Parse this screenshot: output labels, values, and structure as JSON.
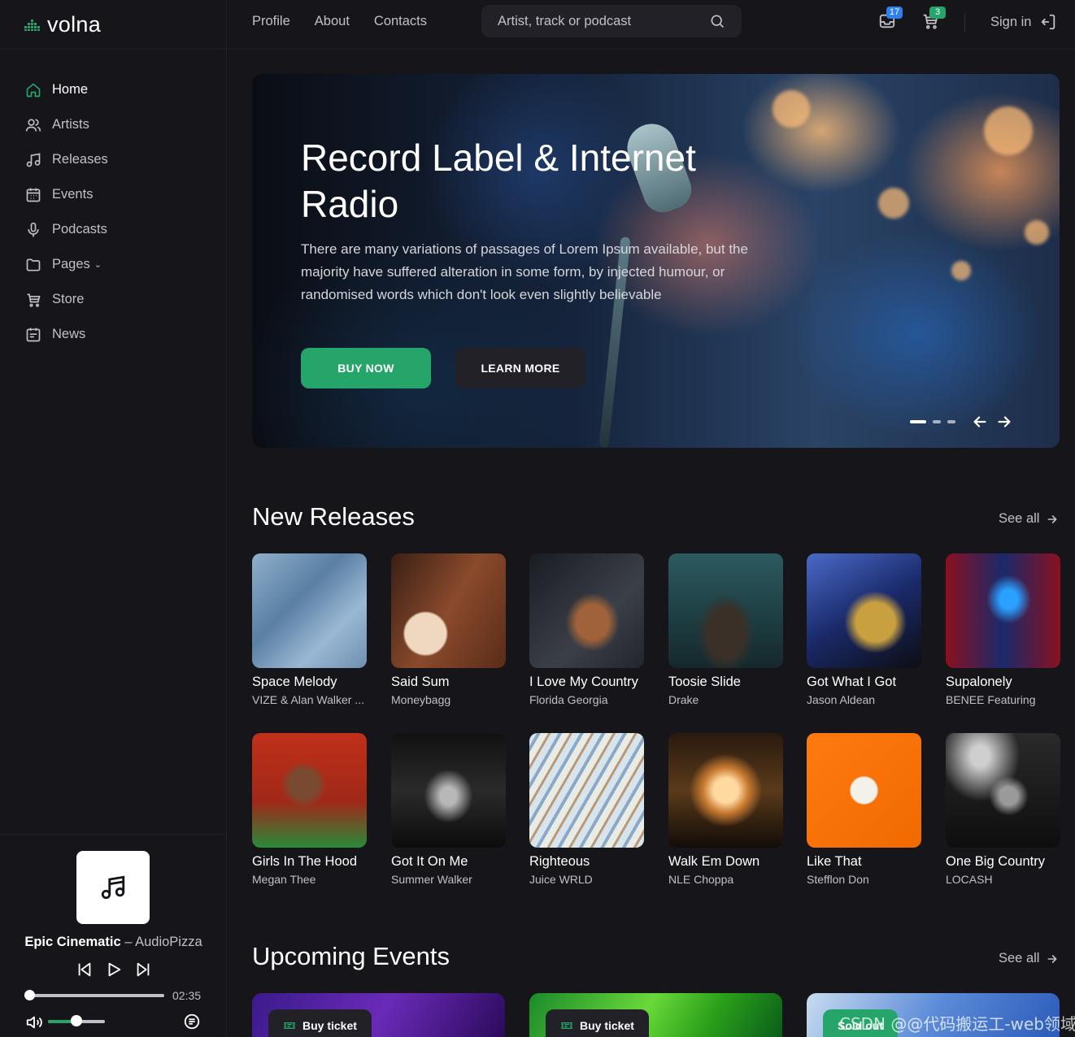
{
  "brand": {
    "name": "volna",
    "logo_icon": "equalizer-logo-icon",
    "accent": "#25a56a"
  },
  "sidebar": {
    "items": [
      {
        "label": "Home",
        "icon": "home-icon",
        "active": true
      },
      {
        "label": "Artists",
        "icon": "users-icon"
      },
      {
        "label": "Releases",
        "icon": "music-note-icon"
      },
      {
        "label": "Events",
        "icon": "calendar-icon"
      },
      {
        "label": "Podcasts",
        "icon": "microphone-icon"
      },
      {
        "label": "Pages",
        "icon": "folder-icon",
        "dropdown": true
      },
      {
        "label": "Store",
        "icon": "cart-icon"
      },
      {
        "label": "News",
        "icon": "newspaper-icon"
      }
    ]
  },
  "player": {
    "title": "Epic Cinematic",
    "separator": "–",
    "artist": "AudioPizza",
    "time": "02:35",
    "progress": 0,
    "volume": 0.5
  },
  "header": {
    "nav": [
      "Profile",
      "About",
      "Contacts"
    ],
    "search_placeholder": "Artist, track or podcast",
    "notifications_count": "17",
    "cart_count": "3",
    "notifications_badge_color": "#2f80ed",
    "cart_badge_color": "#25a56a",
    "signin_label": "Sign in"
  },
  "hero": {
    "title": "Record Label & Internet Radio",
    "text": "There are many variations of passages of Lorem Ipsum available, but the majority have suffered alteration in some form, by injected humour, or randomised words which don't look even slightly believable",
    "buy_label": "BUY NOW",
    "learn_label": "LEARN MORE",
    "slide_count": 3,
    "active_slide": 1
  },
  "new_releases": {
    "title": "New Releases",
    "see_all": "See all",
    "items": [
      {
        "title": "Space Melody",
        "artist": "VIZE & Alan Walker ..."
      },
      {
        "title": "Said Sum",
        "artist": "Moneybagg"
      },
      {
        "title": "I Love My Country",
        "artist": "Florida Georgia"
      },
      {
        "title": "Toosie Slide",
        "artist": "Drake"
      },
      {
        "title": "Got What I Got",
        "artist": "Jason Aldean"
      },
      {
        "title": "Supalonely",
        "artist": "BENEE Featuring"
      },
      {
        "title": "Girls In The Hood",
        "artist": "Megan Thee"
      },
      {
        "title": "Got It On Me",
        "artist": "Summer Walker"
      },
      {
        "title": "Righteous",
        "artist": "Juice WRLD"
      },
      {
        "title": "Walk Em Down",
        "artist": "NLE Choppa"
      },
      {
        "title": "Like That",
        "artist": "Stefflon Don"
      },
      {
        "title": "One Big Country",
        "artist": "LOCASH"
      }
    ]
  },
  "events": {
    "title": "Upcoming Events",
    "see_all": "See all",
    "tickets": [
      {
        "label": "Buy ticket",
        "sold_out": false
      },
      {
        "label": "Buy ticket",
        "sold_out": false
      },
      {
        "label": "Sold out",
        "sold_out": true
      }
    ]
  },
  "watermark": "CSDN @@代码搬运工-web领域"
}
